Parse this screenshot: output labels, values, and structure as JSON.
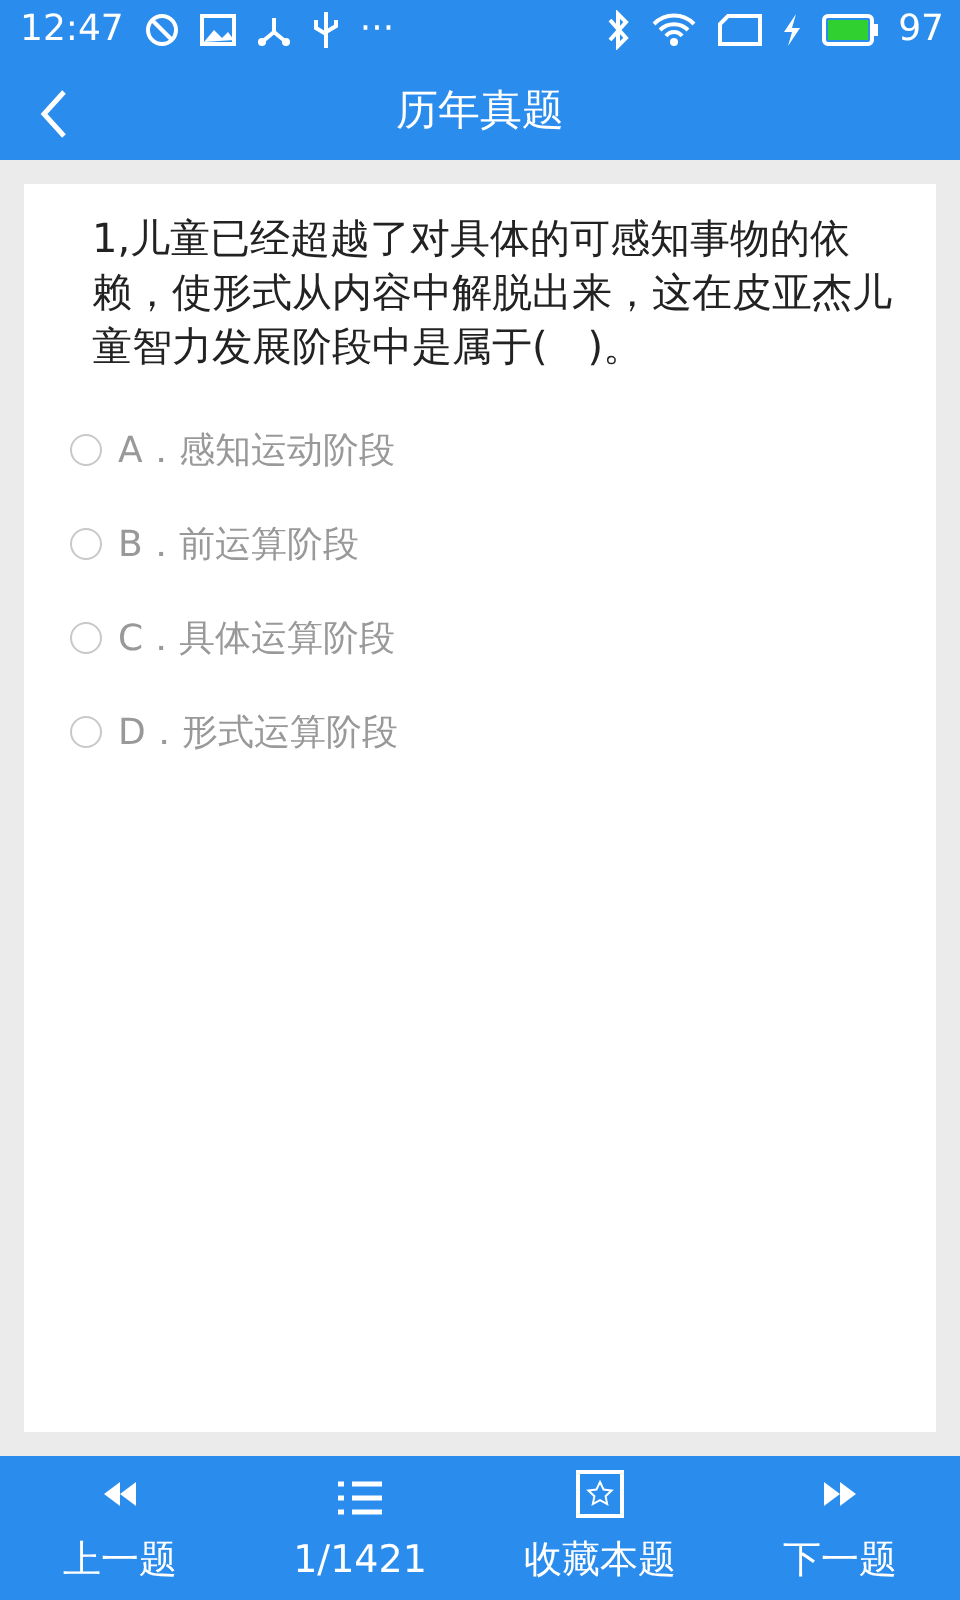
{
  "status_bar": {
    "time": "12:47",
    "more": "···",
    "battery": "97"
  },
  "app_bar": {
    "title": "历年真题"
  },
  "question": {
    "text": "1,儿童已经超越了对具体的可感知事物的依赖，使形式从内容中解脱出来，这在皮亚杰儿童智力发展阶段中是属于(　)。",
    "options": [
      {
        "label": "A．感知运动阶段",
        "selected": false
      },
      {
        "label": "B．前运算阶段",
        "selected": false
      },
      {
        "label": "C．具体运算阶段",
        "selected": false
      },
      {
        "label": "D．形式运算阶段",
        "selected": false
      }
    ]
  },
  "bottom_nav": [
    {
      "kind": "prev",
      "label": "上一题"
    },
    {
      "kind": "list",
      "label": "1/1421"
    },
    {
      "kind": "favorite",
      "label": "收藏本题"
    },
    {
      "kind": "next",
      "label": "下一题"
    }
  ]
}
